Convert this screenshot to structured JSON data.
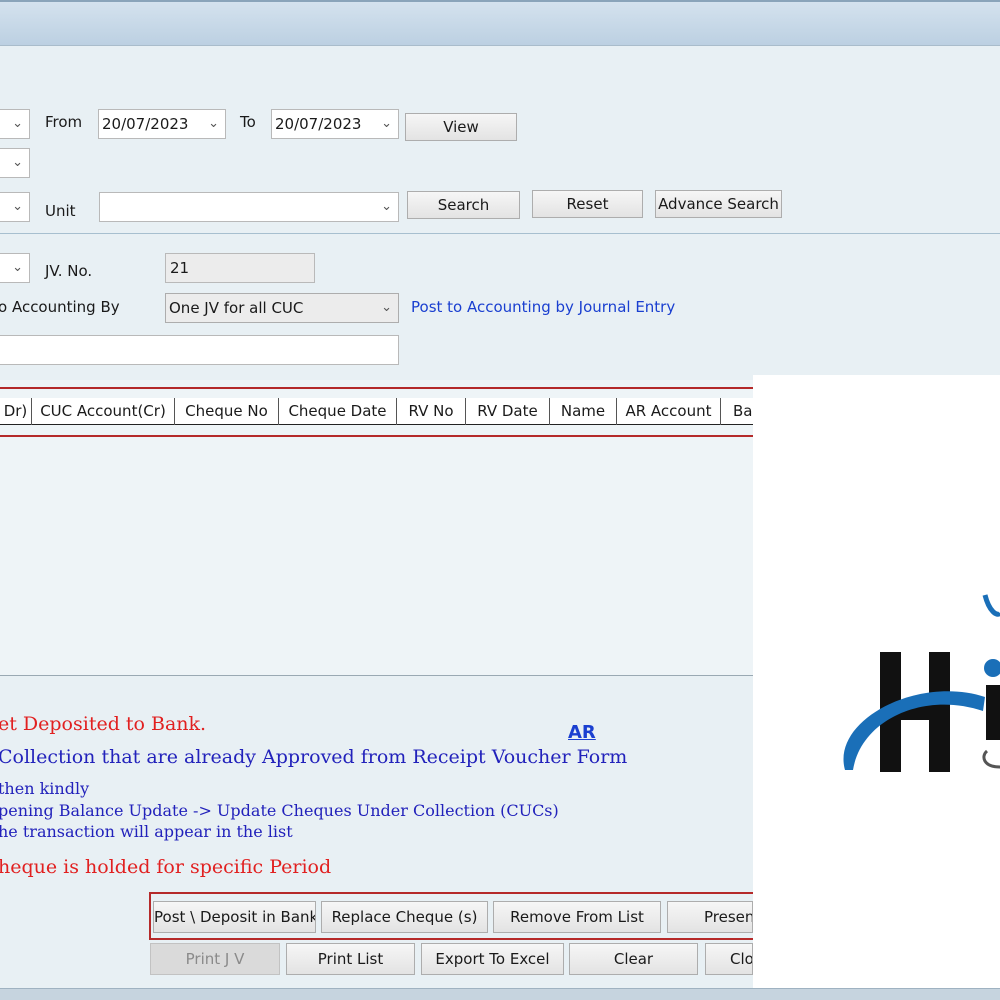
{
  "filters": {
    "from_label": "From",
    "from_date": "20/07/2023",
    "to_label": "To",
    "to_date": "20/07/2023",
    "view_button": "View",
    "unit_label": "Unit",
    "unit_value": "",
    "search_button": "Search",
    "reset_button": "Reset",
    "advance_search_button": "Advance Search"
  },
  "posting": {
    "jv_no_label": "JV. No.",
    "jv_no_value": "21",
    "accounting_by_label": "o Accounting By",
    "accounting_by_value": "One JV for all CUC",
    "journal_entry_link": "Post to Accounting by Journal Entry",
    "remarks_value": ""
  },
  "grid": {
    "columns": [
      "Dr)",
      "CUC Account(Cr)",
      "Cheque No",
      "Cheque Date",
      "RV No",
      "RV Date",
      "Name",
      "AR Account",
      "Ba"
    ]
  },
  "notes": {
    "line1": "et Deposited to Bank.",
    "line2": "Collection that are already Approved from Receipt Voucher Form",
    "ar_link": "AR",
    "line3": "then kindly",
    "line4": "pening Balance Update -> Update Cheques Under Collection (CUCs)",
    "line5": "he transaction will appear in the list",
    "line6": "heque is holded for specific Period"
  },
  "actions": {
    "post_deposit": "Post \\ Deposit in Bank",
    "replace_cheque": "Replace Cheque (s)",
    "remove_from_list": "Remove From List",
    "present": "Presen",
    "print_jv": "Print J V",
    "print_list": "Print List",
    "export_excel": "Export To Excel",
    "clear": "Clear",
    "close": "Clo"
  },
  "logo": {
    "icon": "company-logo",
    "colors": {
      "dark": "#111111",
      "blue": "#1a6fb8"
    }
  }
}
